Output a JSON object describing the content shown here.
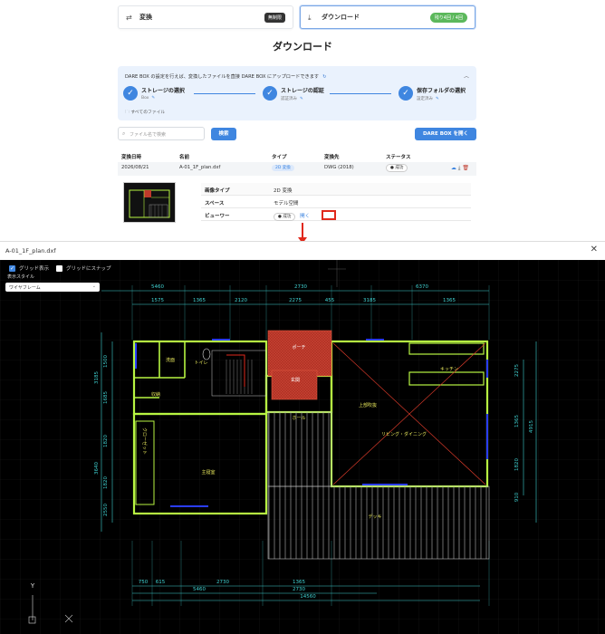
{
  "tabs": [
    {
      "label": "変換",
      "badge": "無制限"
    },
    {
      "label": "ダウンロード",
      "badge": "残り4回 / 4回"
    }
  ],
  "page_title": "ダウンロード",
  "darebox": {
    "info": "DARE BOX の設定を行えば、変換したファイルを直接 DARE BOX にアップロードできます",
    "steps": [
      {
        "title": "ストレージの選択",
        "sub": "Box"
      },
      {
        "title": "ストレージの認証",
        "sub": "認証済み"
      },
      {
        "title": "保存フォルダの選択",
        "sub": "設定済み"
      }
    ],
    "all_files": "すべてのファイル"
  },
  "search": {
    "placeholder": "ファイル名で検索",
    "button": "検索"
  },
  "open_darebox_button": "DARE BOX を開く",
  "table": {
    "headers": [
      "変換日時",
      "名前",
      "タイプ",
      "変換先",
      "ステータス"
    ],
    "row": {
      "date": "2026/08/21",
      "name": "A-01_1F_plan.dxf",
      "type": "2D 変換",
      "target": "DWG (2018)",
      "status": "成功"
    }
  },
  "detail": {
    "rows": [
      {
        "key": "画像タイプ",
        "value": "2D 変換"
      },
      {
        "key": "スペース",
        "value": "モデル空間"
      },
      {
        "key": "ビューワー",
        "value": "成功",
        "link": "開く"
      }
    ]
  },
  "viewer": {
    "filename": "A-01_1F_plan.dxf",
    "grid_display": "グリッド表示",
    "grid_snap": "グリッドにスナップ",
    "display_style_label": "表示スタイル",
    "display_style_value": "ワイヤフレーム",
    "dims_top_outer": [
      "5460",
      "2730",
      "6370"
    ],
    "dims_top_inner": [
      "1575",
      "1365",
      "2120",
      "2275",
      "455",
      "3185",
      "1365"
    ],
    "dims_bottom_inner": [
      "750",
      "615",
      "2730",
      "1365"
    ],
    "dims_bottom_mid": [
      "5460",
      "2730"
    ],
    "dims_bottom_total": "14560",
    "dims_left": [
      "1500",
      "3185",
      "1685",
      "1820",
      "3640",
      "1820",
      "2550"
    ],
    "dims_right": [
      "2275",
      "1365",
      "4915",
      "1820",
      "910"
    ],
    "rooms": [
      "ポーチ",
      "玄関",
      "洗面",
      "トイレ",
      "収納",
      "ホール",
      "主寝室",
      "クローゼット",
      "キッチン",
      "リビング・ダイニング",
      "上部吹抜",
      "デッキ"
    ],
    "axis_y": "Y",
    "colors": {
      "wall": "#b7f542",
      "dim": "#3fd0d0",
      "porch": "#c0392b",
      "text": "#e8e85c"
    }
  }
}
